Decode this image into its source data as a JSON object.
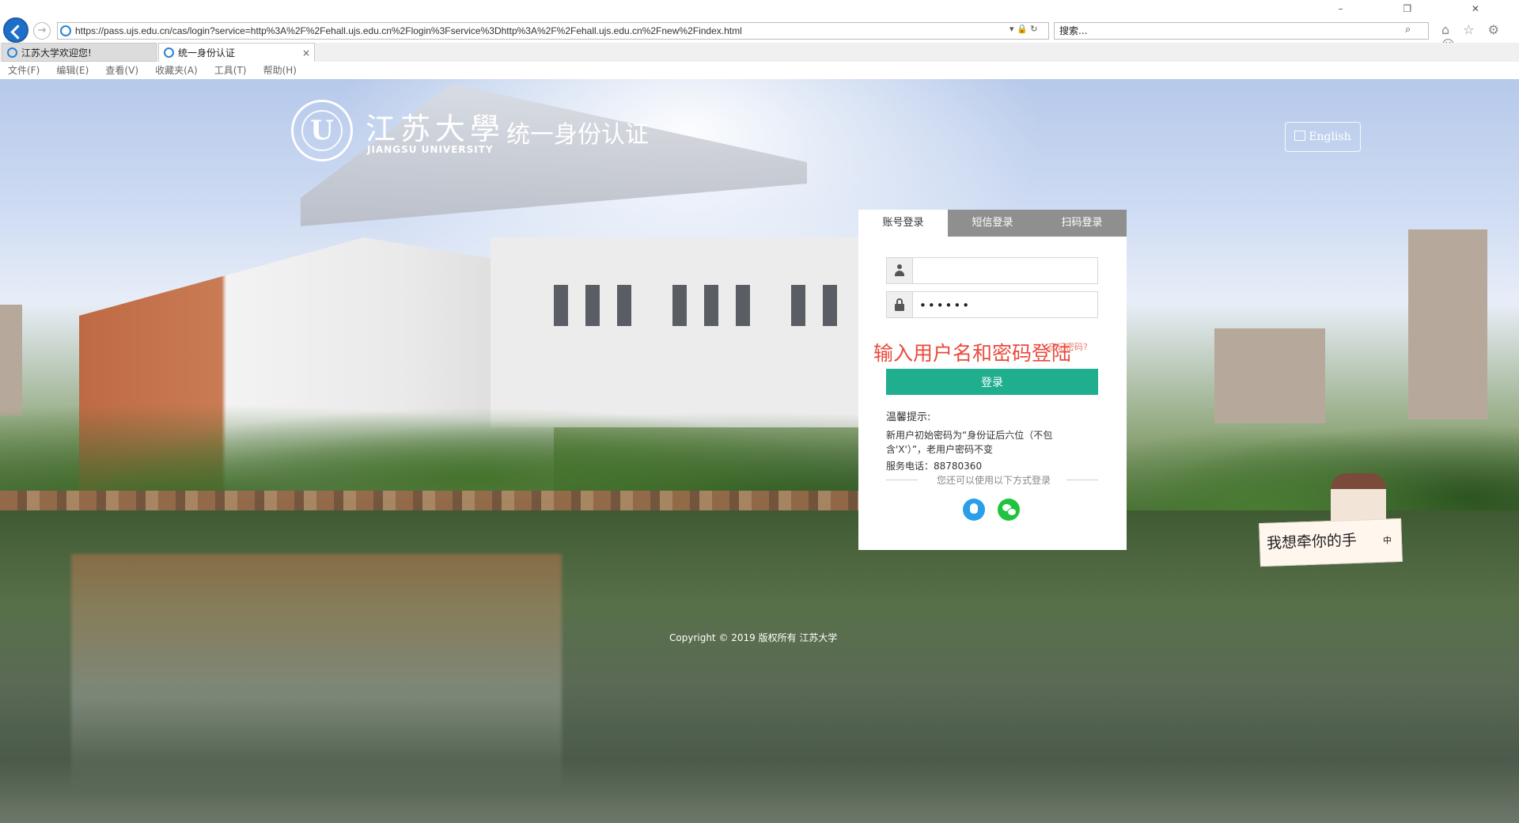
{
  "browser": {
    "url": "https://pass.ujs.edu.cn/cas/login?service=http%3A%2F%2Fehall.ujs.edu.cn%2Flogin%3Fservice%3Dhttp%3A%2F%2Fehall.ujs.edu.cn%2Fnew%2Findex.html",
    "address_actions": "▾ 🔒 ↻",
    "search_value": "搜索...",
    "tabs": [
      {
        "label": "江苏大学欢迎您!"
      },
      {
        "label": "统一身份认证"
      }
    ],
    "tab_close": "×",
    "menu": [
      "文件(F)",
      "编辑(E)",
      "查看(V)",
      "收藏夹(A)",
      "工具(T)",
      "帮助(H)"
    ],
    "window_buttons": "– ❐ ✕",
    "toolbar_icons": "⌂ ☆ ⚙ ☺"
  },
  "header": {
    "school_cn": "江苏大學",
    "school_en": "JIANGSU UNIVERSITY",
    "system_title": "统一身份认证",
    "logo_letter": "U",
    "lang_label": "English"
  },
  "login": {
    "tabs": [
      "账号登录",
      "短信登录",
      "扫码登录"
    ],
    "username": "",
    "password": "••••••",
    "overlay_text": "输入用户名和密码登陆",
    "forgot_label": "忘记密码?",
    "login_label": "登录",
    "tips_title": "温馨提示:",
    "tips_body": "新用户初始密码为“身份证后六位（不包含'X'）”，老用户密码不变",
    "phone": "服务电话：88780360",
    "alt_login": "您还可以使用以下方式登录"
  },
  "footer": {
    "copyright": "Copyright © 2019    版权所有  江苏大学"
  },
  "mascot": {
    "text": "我想牵你的手",
    "badge": "中"
  }
}
